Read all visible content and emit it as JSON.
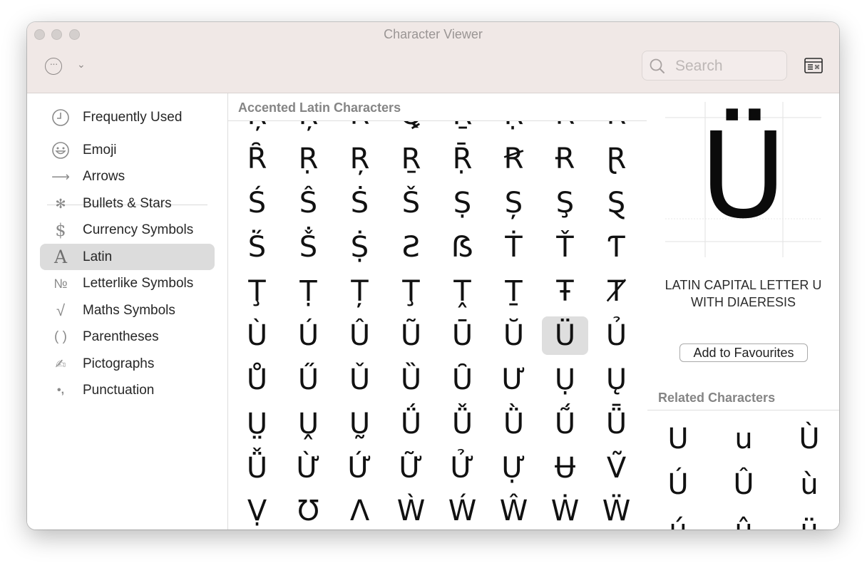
{
  "window": {
    "title": "Character Viewer"
  },
  "toolbar": {
    "more_icon": "ellipsis-circle-icon",
    "search_placeholder": "Search"
  },
  "sidebar": {
    "items": [
      {
        "label": "Frequently Used",
        "icon": "clock-icon",
        "glyph": ""
      },
      {
        "label": "Emoji",
        "icon": "smiley-icon",
        "glyph": ""
      },
      {
        "label": "Arrows",
        "icon": "arrow-icon",
        "glyph": "⟶"
      },
      {
        "label": "Bullets & Stars",
        "icon": "asterisk-icon",
        "glyph": "✻"
      },
      {
        "label": "Currency Symbols",
        "icon": "dollar-icon",
        "glyph": "$"
      },
      {
        "label": "Latin",
        "icon": "latin-a-icon",
        "glyph": "A",
        "selected": true
      },
      {
        "label": "Letterlike Symbols",
        "icon": "numero-icon",
        "glyph": "№"
      },
      {
        "label": "Maths Symbols",
        "icon": "square-root-icon",
        "glyph": "√"
      },
      {
        "label": "Parentheses",
        "icon": "parentheses-icon",
        "glyph": "( )"
      },
      {
        "label": "Pictographs",
        "icon": "writing-hand-icon",
        "glyph": "✍"
      },
      {
        "label": "Punctuation",
        "icon": "punctuation-icon",
        "glyph": "•,"
      }
    ]
  },
  "grid": {
    "title": "Accented Latin Characters",
    "selected": "Ü",
    "rows": [
      [
        "Ŗ",
        "Ŗ",
        "Ṙ",
        "Ꝗ",
        "Ṟ",
        "Ṛ",
        "Ř",
        "Ȓ"
      ],
      [
        "Ȓ",
        "Ṛ",
        "Ŗ",
        "Ṟ",
        "Ṝ",
        "Ꞧ",
        "Ɍ",
        "Ɽ"
      ],
      [
        "Ś",
        "Ŝ",
        "Ṡ",
        "Š",
        "Ṣ",
        "Ș",
        "Ş",
        "Ȿ"
      ],
      [
        "Ṥ",
        "Ṧ",
        "Ṩ",
        "Ƨ",
        "ẞ",
        "Ṫ",
        "Ť",
        "Ƭ"
      ],
      [
        "Ţ",
        "Ṭ",
        "Ț",
        "Ţ",
        "Ṱ",
        "Ṯ",
        "Ŧ",
        "Ⱦ"
      ],
      [
        "Ù",
        "Ú",
        "Û",
        "Ũ",
        "Ū",
        "Ŭ",
        "Ü",
        "Ủ"
      ],
      [
        "Ů",
        "Ű",
        "Ǔ",
        "Ȕ",
        "Ȗ",
        "Ư",
        "Ụ",
        "Ų"
      ],
      [
        "Ṳ",
        "Ṷ",
        "Ṵ",
        "Ǘ",
        "Ǚ",
        "Ǜ",
        "Ṹ",
        "Ǖ"
      ],
      [
        "Ǚ",
        "Ừ",
        "Ứ",
        "Ữ",
        "Ử",
        "Ự",
        "Ʉ",
        "Ṽ"
      ],
      [
        "Ṿ",
        "Ʊ",
        "Ʌ",
        "Ẁ",
        "Ẃ",
        "Ŵ",
        "Ẇ",
        "Ẅ"
      ]
    ]
  },
  "detail": {
    "char": "Ü",
    "name": "LATIN CAPITAL LETTER U WITH DIAERESIS",
    "fav_button": "Add to Favourites",
    "related_title": "Related Characters",
    "related": [
      "U",
      "u",
      "Ù",
      "Ú",
      "Û",
      "ù",
      "ú",
      "û",
      "ü"
    ]
  }
}
